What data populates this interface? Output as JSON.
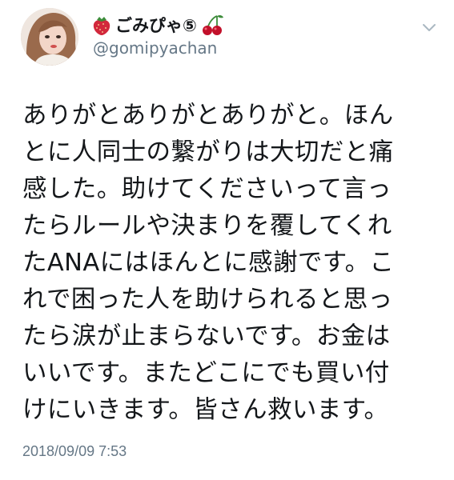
{
  "header": {
    "display_name": "ごみぴゃ⑤",
    "handle": "@gomipyachan",
    "name_prefix_icon": "strawberry-icon",
    "name_suffix_icon": "cherries-icon",
    "menu_icon": "chevron-down-icon"
  },
  "tweet": {
    "lines": [
      "ありがとありがとありがと。ほん",
      "とに人同士の繋がりは大切だと痛",
      "感した。助けてくださいって言っ",
      "たらルールや決まりを覆してくれ",
      "たANAにはほんとに感謝です。こ",
      "れで困った人を助けられると思っ",
      "たら涙が止まらないです。お金は",
      "いいです。またどこにでも買い付",
      "けにいきます。皆さん救います。"
    ],
    "timestamp": "2018/09/09 7:53"
  },
  "colors": {
    "text": "#14171a",
    "secondary": "#657786",
    "strawberry": "#d2283c",
    "cherry": "#c2102a",
    "leaf": "#3d8c3a"
  }
}
